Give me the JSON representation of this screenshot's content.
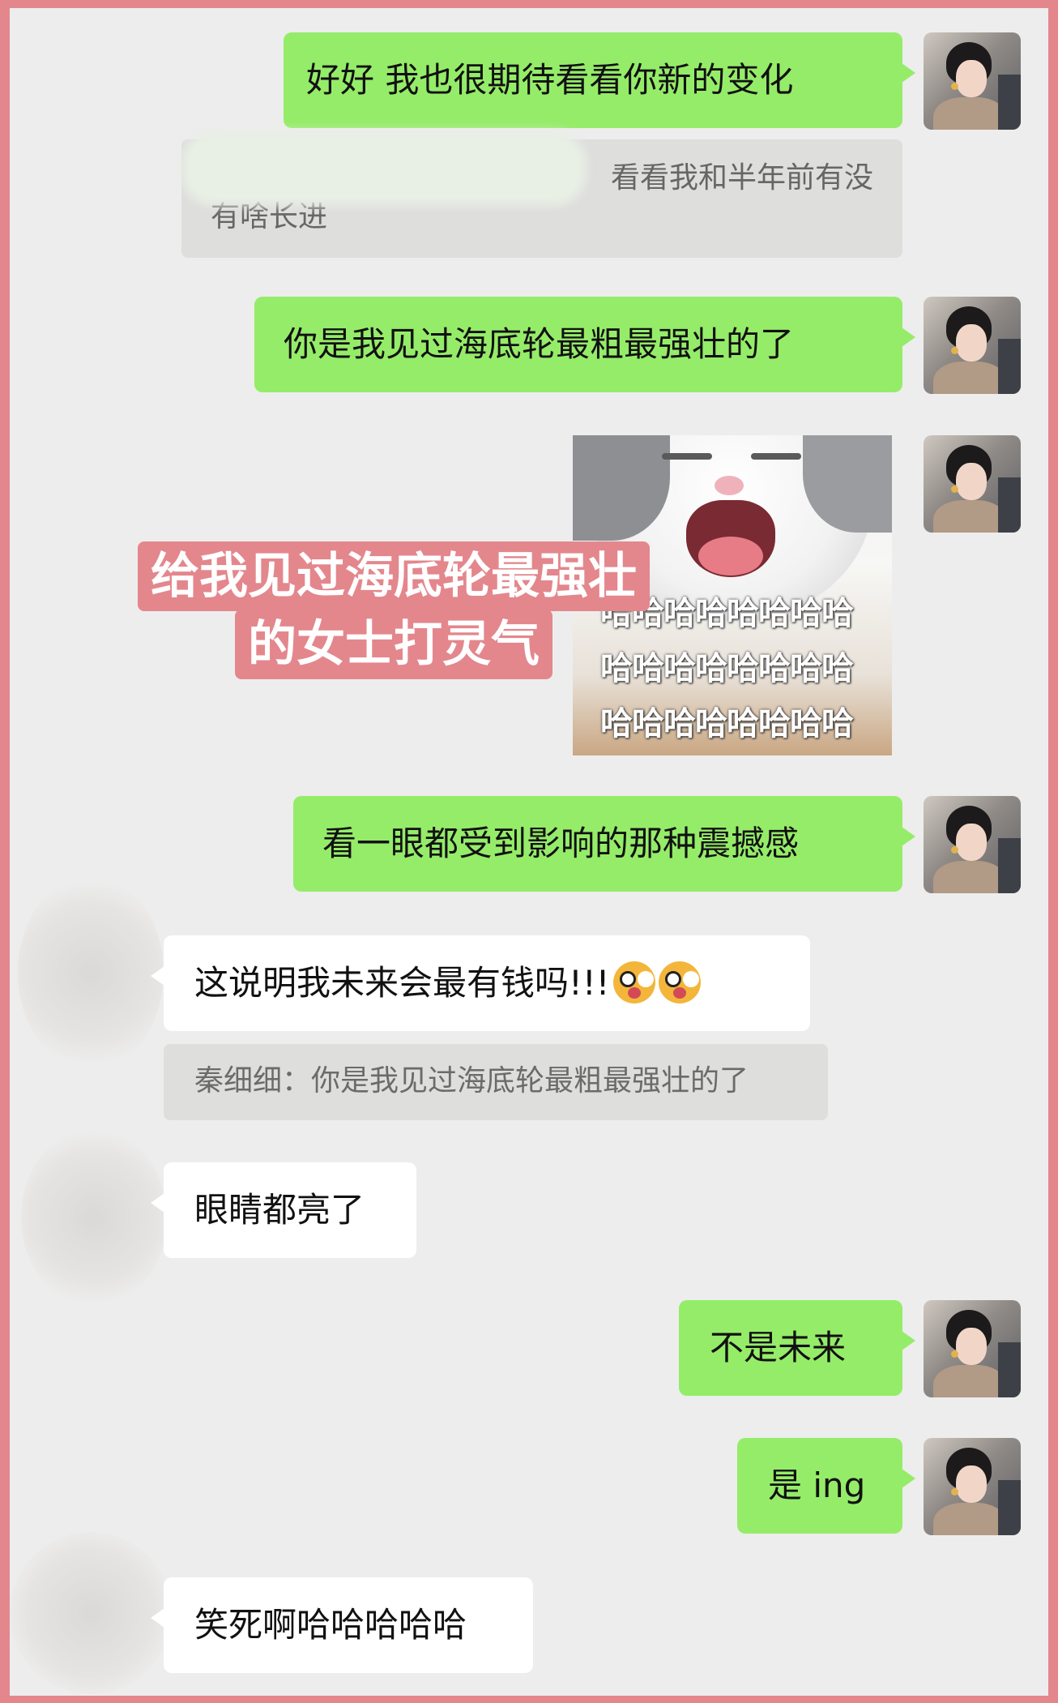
{
  "messages": {
    "m1": "好好 我也很期待看看你新的变化",
    "q1_line1": "看看我和半年前有没",
    "q1_line2": "有啥长进",
    "m2": "你是我见过海底轮最粗最强壮的了",
    "sticker_caption": "哈哈哈哈哈哈哈哈哈哈哈哈哈哈哈哈哈哈哈哈哈哈哈哈",
    "overlay_line1": "给我见过海底轮最强壮",
    "overlay_line2": "的女士打灵气",
    "m3": "看一眼都受到影响的那种震撼感",
    "r1": "这说明我未来会最有钱吗!!!",
    "r1_quote": "秦细细：你是我见过海底轮最粗最强壮的了",
    "r2": "眼睛都亮了",
    "m4": "不是未来",
    "m5": "是 ing",
    "r3": "笑死啊哈哈哈哈哈"
  },
  "icons": {
    "emoji": "starstruck-tongue-emoji",
    "avatar_self": "user-avatar",
    "avatar_other": "contact-avatar-blurred"
  },
  "colors": {
    "frame": "#e3878d",
    "chat_bg": "#ededed",
    "bubble_self": "#95ec69",
    "bubble_other": "#ffffff",
    "quote_bg": "#dededd"
  }
}
